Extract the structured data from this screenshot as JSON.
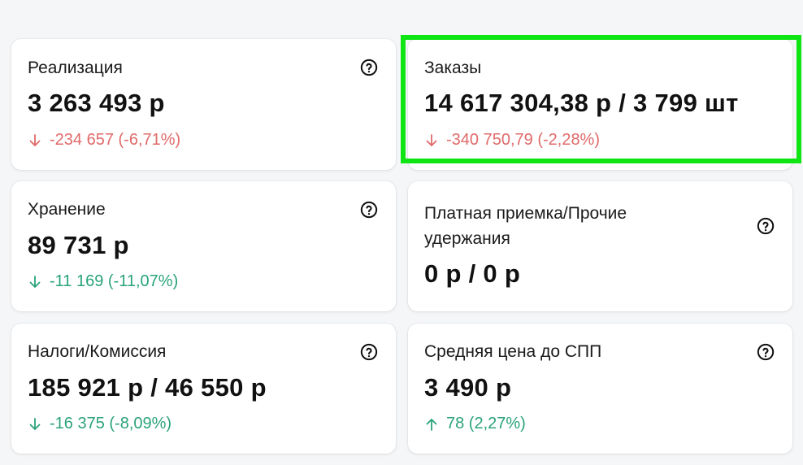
{
  "colors": {
    "negative": "#e06a6a",
    "positive": "#2aa37a",
    "highlight": "#10e514"
  },
  "cards": [
    {
      "title": "Реализация",
      "value": "3 263 493 р",
      "delta": "-234 657 (-6,71%)",
      "direction": "down",
      "tone": "negative",
      "icon": "help-circle-icon"
    },
    {
      "title": "Заказы",
      "value": "14 617 304,38 р / 3 799 шт",
      "delta": "-340 750,79 (-2,28%)",
      "direction": "down",
      "tone": "negative"
    },
    {
      "title": "Хранение",
      "value": "89 731 р",
      "delta": "-11 169 (-11,07%)",
      "direction": "down",
      "tone": "positive",
      "icon": "help-circle-icon"
    },
    {
      "title_line1": "Платная приемка/Прочие",
      "title_line2": "удержания",
      "value": "0 р / 0 р",
      "icon": "help-circle-icon"
    },
    {
      "title": "Налоги/Комиссия",
      "value": "185 921 р / 46 550 р",
      "delta": "-16 375 (-8,09%)",
      "direction": "down",
      "tone": "positive",
      "icon": "help-circle-icon"
    },
    {
      "title": "Средняя цена до СПП",
      "value": "3 490 р",
      "delta": "78 (2,27%)",
      "direction": "up",
      "tone": "positive",
      "icon": "help-circle-icon"
    }
  ]
}
